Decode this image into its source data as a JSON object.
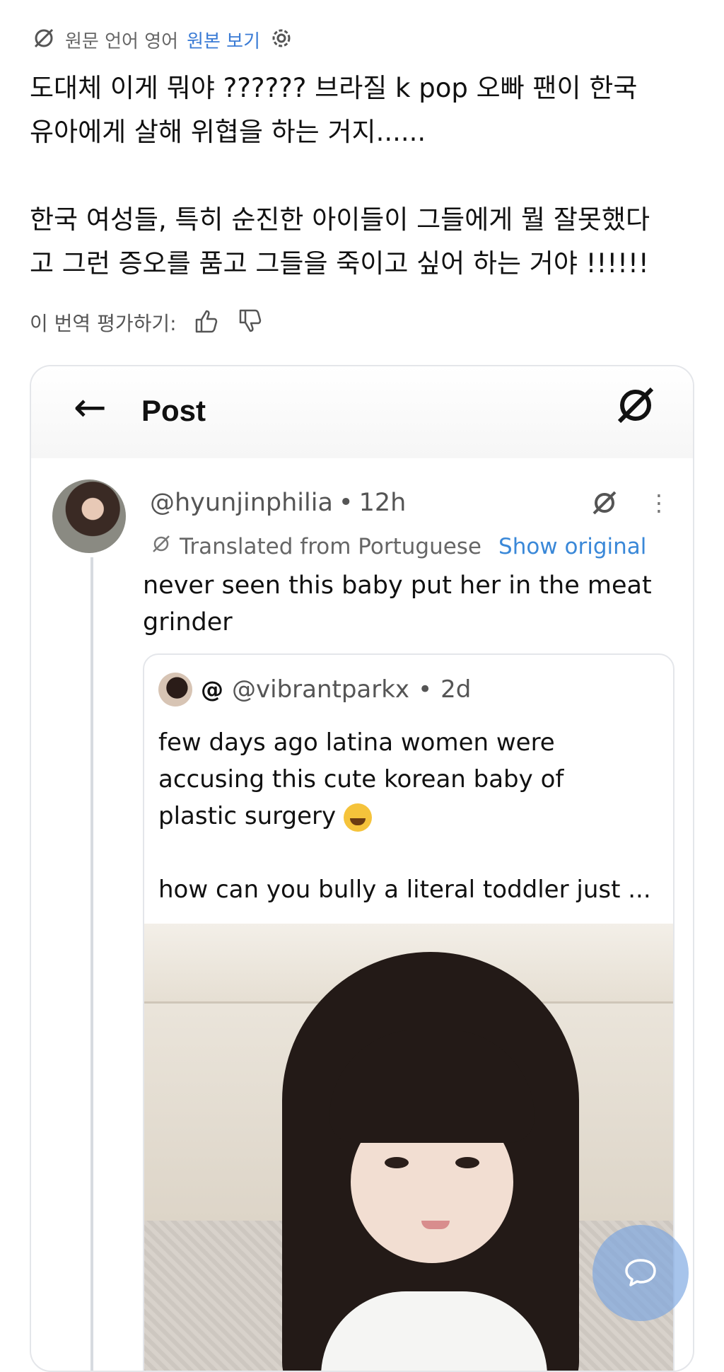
{
  "translation_bar": {
    "source_language": "원문 언어 영어",
    "view_original": "원본 보기"
  },
  "translated_body": {
    "paragraph1_line1": "도대체 이게 뭐야 ?????? 브라질 k pop 오빠 팬이 한국",
    "paragraph1_line2": "유아에게 살해 위협을 하는 거지......",
    "paragraph2_line1": "한국 여성들, 특히 순진한 아이들이 그들에게 뭘 잘못했다",
    "paragraph2_line2": "고 그런 증오를 품고 그들을 죽이고 싶어 하는 거야 !!!!!!"
  },
  "rating": {
    "label": "이 번역 평가하기:"
  },
  "embedded_screenshot": {
    "header_title": "Post",
    "back_arrow": "←",
    "tweet": {
      "handle": "@hyunjinphilia",
      "separator": "•",
      "time": "12h",
      "more": "⋮",
      "translated_label": "Translated from Portuguese",
      "show_original": "Show original",
      "text_line1": "never seen this baby put her in the meat",
      "text_line2": "grinder"
    },
    "quoted_tweet": {
      "at_symbol": "@",
      "handle": "@vibrantparkx",
      "separator": "•",
      "time": "2d",
      "line1": "few days ago latina women were",
      "line2": "accusing this cute korean baby of",
      "line3": "plastic surgery",
      "line4": "how can you bully a literal toddler just ..."
    }
  },
  "colors": {
    "link": "#3a7bd5",
    "muted": "#666666",
    "border": "#e4e6ea",
    "fab": "#78a5e1"
  },
  "icons": [
    "translate-slash-icon",
    "gear-icon",
    "thumbs-up-icon",
    "thumbs-down-icon",
    "grok-logo-icon",
    "more-vertical-icon",
    "chat-bubble-icon"
  ]
}
